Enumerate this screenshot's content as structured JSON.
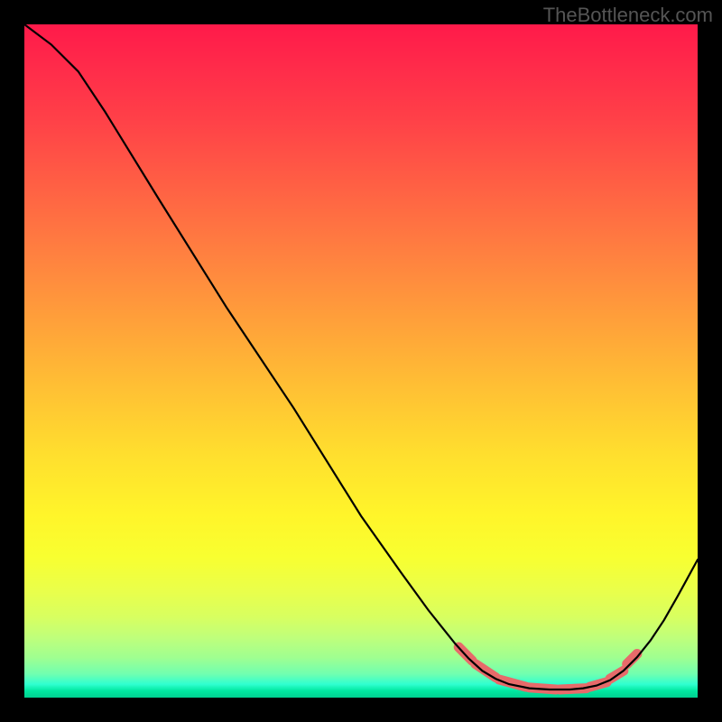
{
  "watermark": "TheBottleneck.com",
  "chart_data": {
    "type": "line",
    "title": "",
    "xlabel": "",
    "ylabel": "",
    "xlim": [
      0,
      100
    ],
    "ylim": [
      0,
      100
    ],
    "curve": {
      "name": "bottleneck-curve",
      "points": [
        {
          "x": 0,
          "y": 100
        },
        {
          "x": 4,
          "y": 97
        },
        {
          "x": 8,
          "y": 93
        },
        {
          "x": 12,
          "y": 87
        },
        {
          "x": 20,
          "y": 74
        },
        {
          "x": 30,
          "y": 58
        },
        {
          "x": 40,
          "y": 43
        },
        {
          "x": 50,
          "y": 27
        },
        {
          "x": 56,
          "y": 18.5
        },
        {
          "x": 60,
          "y": 13
        },
        {
          "x": 62,
          "y": 10.5
        },
        {
          "x": 64,
          "y": 8
        },
        {
          "x": 66,
          "y": 5.8
        },
        {
          "x": 68,
          "y": 4
        },
        {
          "x": 70,
          "y": 2.8
        },
        {
          "x": 72,
          "y": 2
        },
        {
          "x": 75,
          "y": 1.4
        },
        {
          "x": 78,
          "y": 1.2
        },
        {
          "x": 81,
          "y": 1.2
        },
        {
          "x": 83,
          "y": 1.4
        },
        {
          "x": 85,
          "y": 1.8
        },
        {
          "x": 87,
          "y": 2.6
        },
        {
          "x": 89,
          "y": 4
        },
        {
          "x": 91,
          "y": 6
        },
        {
          "x": 93,
          "y": 8.5
        },
        {
          "x": 95,
          "y": 11.5
        },
        {
          "x": 97,
          "y": 15
        },
        {
          "x": 100,
          "y": 20.5
        }
      ]
    },
    "highlight_segments": [
      {
        "x1": 64.5,
        "y1": 7.5,
        "x2": 66.5,
        "y2": 5.5
      },
      {
        "x1": 67,
        "y1": 5,
        "x2": 70,
        "y2": 3
      },
      {
        "x1": 70.5,
        "y1": 2.7,
        "x2": 74.5,
        "y2": 1.6
      },
      {
        "x1": 75,
        "y1": 1.5,
        "x2": 79,
        "y2": 1.2
      },
      {
        "x1": 79.5,
        "y1": 1.2,
        "x2": 83.5,
        "y2": 1.4
      },
      {
        "x1": 84,
        "y1": 1.6,
        "x2": 86.5,
        "y2": 2.3
      },
      {
        "x1": 87,
        "y1": 2.8,
        "x2": 89,
        "y2": 4
      },
      {
        "x1": 89.5,
        "y1": 5,
        "x2": 91,
        "y2": 6.5
      }
    ],
    "gradient_stops": [
      {
        "pos": 0,
        "color": "#ff1a4a"
      },
      {
        "pos": 50,
        "color": "#ffc034"
      },
      {
        "pos": 75,
        "color": "#fff52a"
      },
      {
        "pos": 100,
        "color": "#00d090"
      }
    ]
  }
}
